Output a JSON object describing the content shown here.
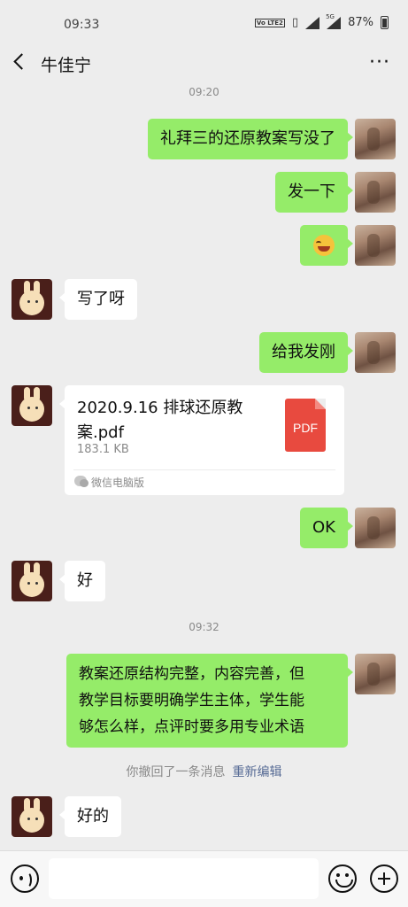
{
  "status_bar": {
    "time": "09:33",
    "volte": "Vo LTE2",
    "network": "5G",
    "battery": "87%"
  },
  "header": {
    "title": "牛佳宁",
    "more": "···"
  },
  "timestamps": [
    "09:20",
    "09:32"
  ],
  "messages": [
    {
      "from": "me",
      "type": "text",
      "text": "礼拜三的还原教案写没了"
    },
    {
      "from": "me",
      "type": "text",
      "text": "发一下"
    },
    {
      "from": "me",
      "type": "emoji",
      "icon": "laughing-emoji-icon"
    },
    {
      "from": "other",
      "type": "text",
      "text": "写了呀"
    },
    {
      "from": "me",
      "type": "text",
      "text": "给我发刚"
    },
    {
      "from": "other",
      "type": "file",
      "name": "2020.9.16 排球还原教案.pdf",
      "size": "183.1 KB",
      "source": "微信电脑版",
      "badge": "PDF"
    },
    {
      "from": "me",
      "type": "text",
      "text": "OK"
    },
    {
      "from": "other",
      "type": "text",
      "text": "好"
    },
    {
      "from": "me",
      "type": "text",
      "lines": [
        "教案还原结构完整，内容完善，但",
        "教学目标要明确学生主体，学生能",
        "够怎么样，点评时要多用专业术语"
      ]
    },
    {
      "from": "other",
      "type": "text",
      "text": "好的"
    }
  ],
  "recall_notice": {
    "text": "你撤回了一条消息",
    "action": "重新编辑"
  },
  "input_bar": {
    "placeholder": ""
  },
  "colors": {
    "background": "#ededed",
    "my_bubble": "#95ec69",
    "other_bubble": "#ffffff",
    "link": "#576b95"
  }
}
